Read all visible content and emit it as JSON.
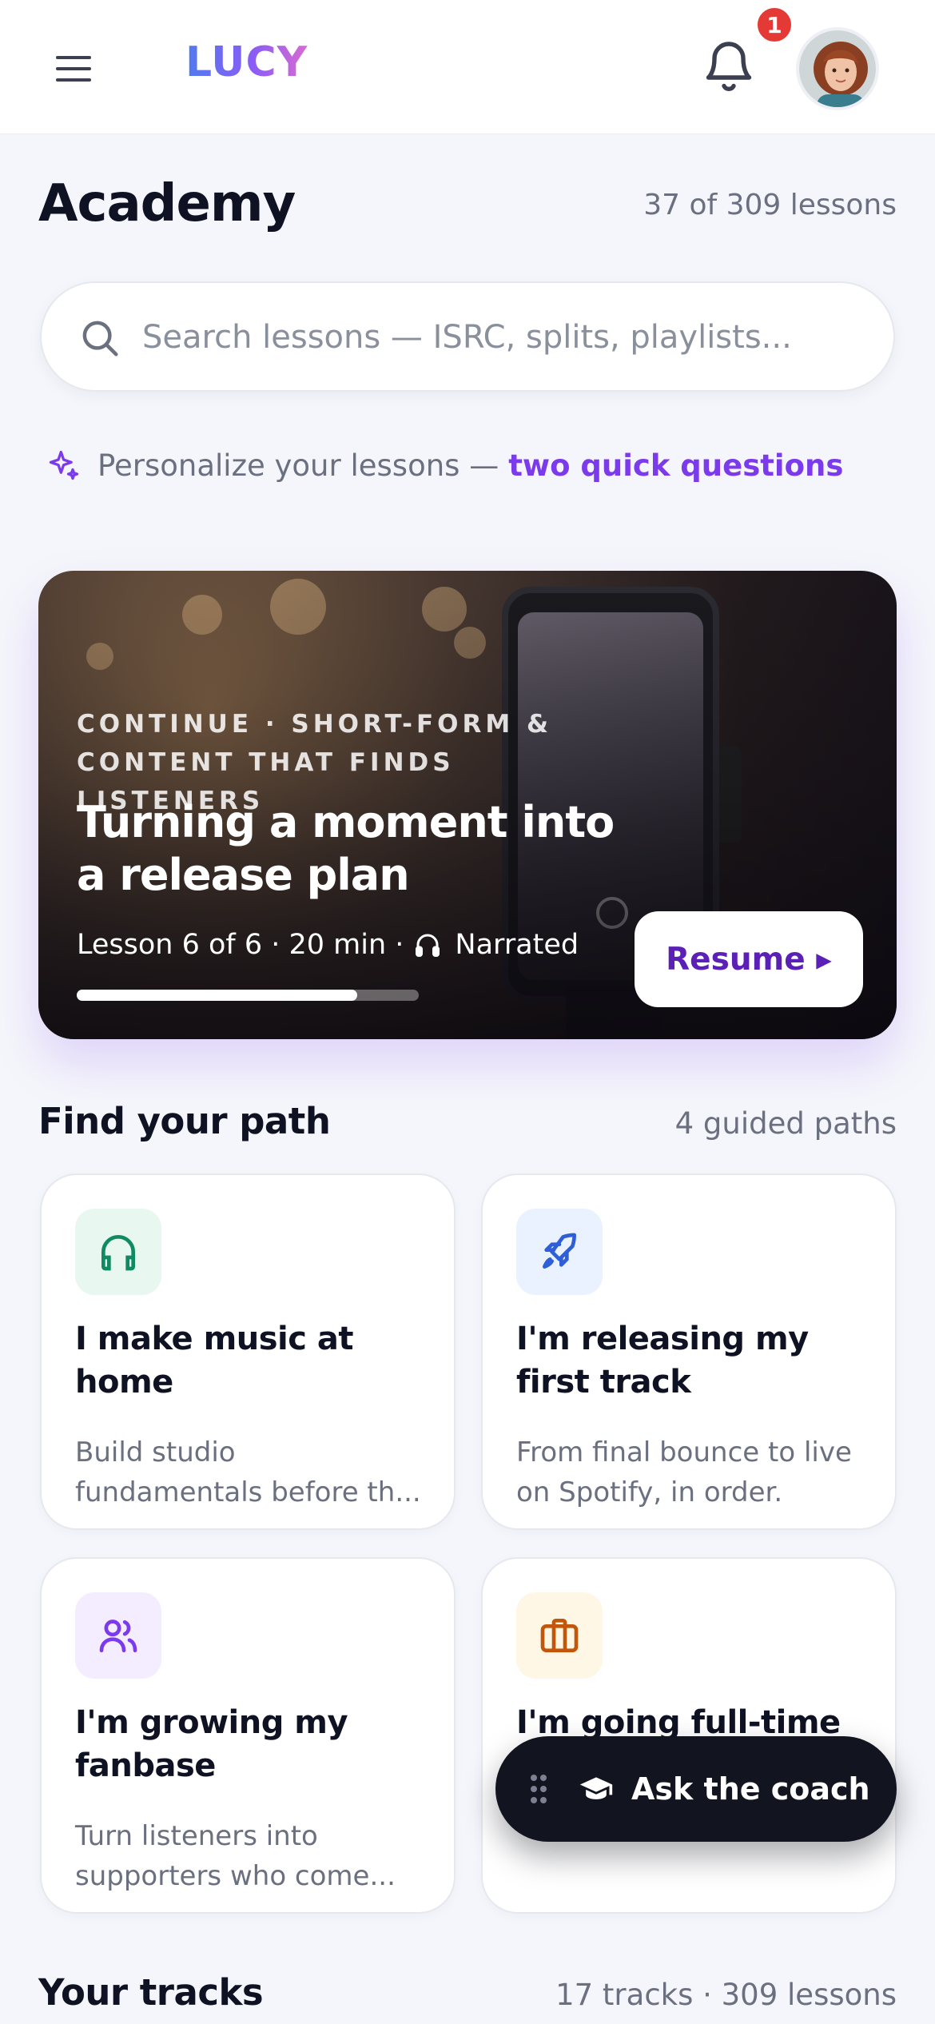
{
  "header": {
    "logo_text": "LUCY",
    "notification_count": "1"
  },
  "academy": {
    "title": "Academy",
    "lesson_count": "37 of 309 lessons"
  },
  "search": {
    "placeholder": "Search lessons — ISRC, splits, playlists..."
  },
  "personalize": {
    "prefix": "Personalize your lessons —",
    "link": "two quick questions"
  },
  "hero": {
    "eyebrow": "CONTINUE · SHORT-FORM & CONTENT THAT FINDS LISTENERS",
    "title": "Turning a moment into a release plan",
    "meta_left": "Lesson 6 of 6 · 20 min ·",
    "meta_right": "Narrated",
    "progress_fraction": 0.82,
    "resume_label": "Resume ▸"
  },
  "paths": {
    "title": "Find your path",
    "meta": "4 guided paths",
    "cards": [
      {
        "title": "I make music at home",
        "desc": "Build studio fundamentals before th...",
        "icon": "headphones-icon",
        "icon_color": "#0f8a63",
        "icon_bg": "#e8f7f0"
      },
      {
        "title": "I'm releasing my first track",
        "desc": "From final bounce to live on Spotify, in order.",
        "icon": "rocket-icon",
        "icon_color": "#2f5fd6",
        "icon_bg": "#eaf1ff"
      },
      {
        "title": "I'm growing my fanbase",
        "desc": "Turn listeners into supporters who come...",
        "icon": "users-icon",
        "icon_color": "#7c3aed",
        "icon_bg": "#f3edff"
      },
      {
        "title": "I'm going full-time",
        "desc": "",
        "icon": "briefcase-icon",
        "icon_color": "#c2570c",
        "icon_bg": "#fff7e6"
      }
    ]
  },
  "tracks": {
    "title": "Your tracks",
    "meta": "17 tracks · 309 lessons"
  },
  "coach": {
    "label": "Ask the coach"
  },
  "colors": {
    "accent": "#7c3aed",
    "text": "#0f1222",
    "muted": "#6b7080",
    "badge": "#e53935"
  }
}
